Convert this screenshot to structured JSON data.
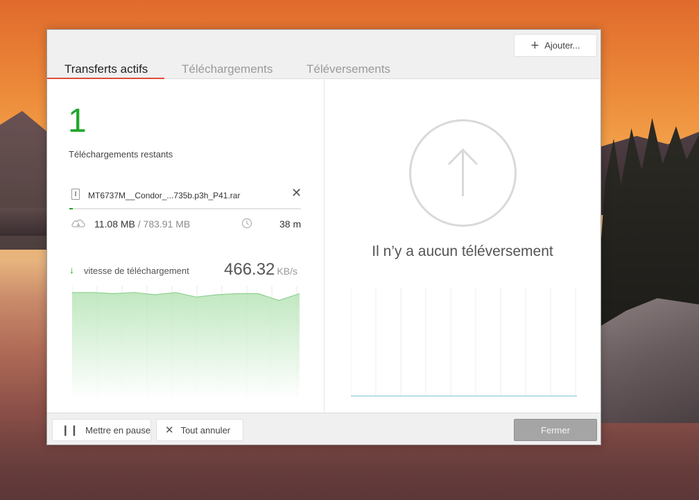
{
  "header": {
    "add_button_label": "Ajouter...",
    "tabs": [
      {
        "label": "Transferts actifs",
        "active": true
      },
      {
        "label": "Téléchargements",
        "active": false
      },
      {
        "label": "Téléversements",
        "active": false
      }
    ]
  },
  "downloads": {
    "remaining_count": "1",
    "remaining_label": "Téléchargements restants",
    "file": {
      "name": "MT6737M__Condor_...735b.p3h_P41.rar",
      "downloaded": "11.08 MB",
      "total": " / 783.91 MB",
      "progress_fraction": 0.014,
      "time_remaining": "38 m"
    },
    "speed_label": "vitesse de téléchargement",
    "speed_value": "466.32",
    "speed_unit": "KB/s",
    "speed_history": [
      94,
      94,
      93,
      94,
      92,
      94,
      90,
      92,
      93,
      93,
      87,
      93
    ]
  },
  "uploads": {
    "empty_message": "Il n’y a aucun téléversement"
  },
  "footer": {
    "pause_label": "Mettre en pause",
    "cancel_all_label": "Tout annuler",
    "close_label": "Fermer"
  },
  "colors": {
    "accent_green": "#1fa62b",
    "tab_underline": "#e04a3a",
    "upload_baseline": "#9fd6de"
  },
  "icons": {
    "add": "plus-icon",
    "file": "file-icon",
    "remove": "close-icon",
    "download_cloud": "cloud-download-icon",
    "time": "clock-icon",
    "speed": "arrow-down-icon",
    "upload": "upload-arrow-icon",
    "pause": "pause-icon",
    "cancel": "close-icon"
  }
}
